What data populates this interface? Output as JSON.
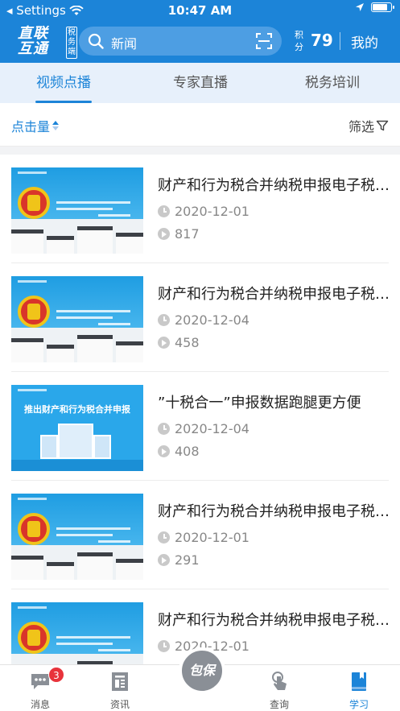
{
  "status_bar": {
    "back_label": "◂ Settings",
    "time": "10:47 AM"
  },
  "header": {
    "logo_main": "直联互通",
    "logo_side": "税务端",
    "search_text": "新闻",
    "points_label": "积分",
    "points_value": "79",
    "mine_label": "我的"
  },
  "tabs": [
    {
      "label": "视频点播",
      "active": true
    },
    {
      "label": "专家直播",
      "active": false
    },
    {
      "label": "税务培训",
      "active": false
    }
  ],
  "filter": {
    "sort_label": "点击量",
    "filter_label": "筛选"
  },
  "videos": [
    {
      "title": "财产和行为税合并纳税申报电子税务局操作",
      "date": "2020-12-01",
      "views": "817"
    },
    {
      "title": "财产和行为税合并纳税申报电子税务局操作",
      "date": "2020-12-04",
      "views": "458"
    },
    {
      "title": "”十税合一”申报数据跑腿更方便",
      "date": "2020-12-04",
      "views": "408",
      "thumb_banner": "推出财产和行为税合并申报"
    },
    {
      "title": "财产和行为税合并纳税申报电子税务局操作",
      "date": "2020-12-01",
      "views": "291"
    },
    {
      "title": "财产和行为税合并纳税申报电子税务局操作",
      "date": "2020-12-01",
      "views": ""
    }
  ],
  "tabbar": {
    "messages": {
      "label": "消息",
      "badge": "3"
    },
    "news": {
      "label": "资讯"
    },
    "center": {
      "label": "包保"
    },
    "query": {
      "label": "查询"
    },
    "study": {
      "label": "学习"
    }
  },
  "colors": {
    "primary": "#1c84d8",
    "badge": "#e8333b",
    "tab_bg": "#e7f0fb"
  }
}
